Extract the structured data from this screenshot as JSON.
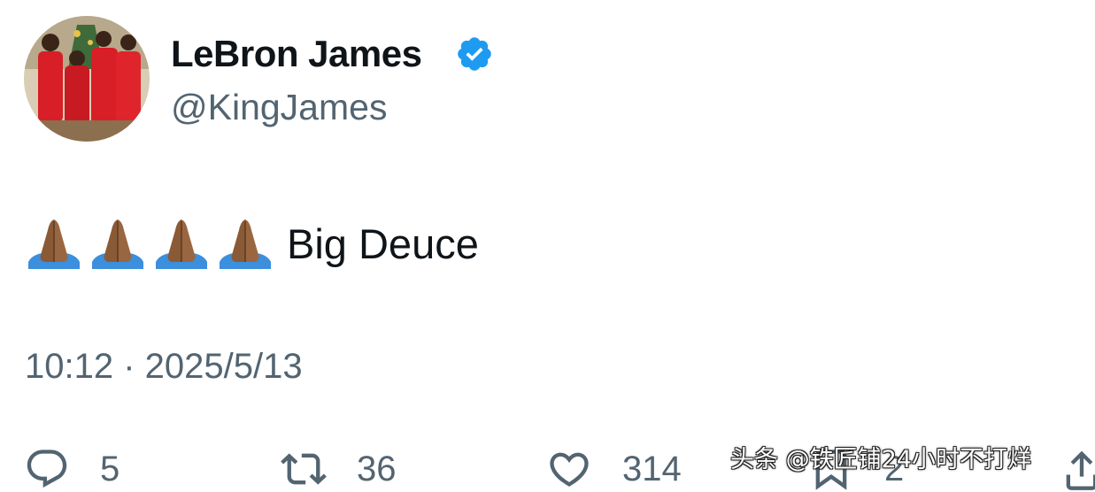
{
  "user": {
    "display_name": "LeBron James",
    "handle": "@KingJames",
    "verified": true,
    "verified_color": "#1d9bf0",
    "avatar_icon": "family-photo-avatar"
  },
  "tweet": {
    "emoji": [
      "🙏🏾",
      "🙏🏾",
      "🙏🏾",
      "🙏🏾"
    ],
    "text": "Big Deuce",
    "timestamp": "10:12 · 2025/5/13"
  },
  "actions": {
    "reply_count": "5",
    "retweet_count": "36",
    "like_count": "314",
    "bookmark_count": "2"
  },
  "watermark": {
    "text": "头条 @铁匠铺24小时不打烊"
  },
  "colors": {
    "text_primary": "#0f1419",
    "text_secondary": "#536471",
    "accent": "#1d9bf0"
  }
}
